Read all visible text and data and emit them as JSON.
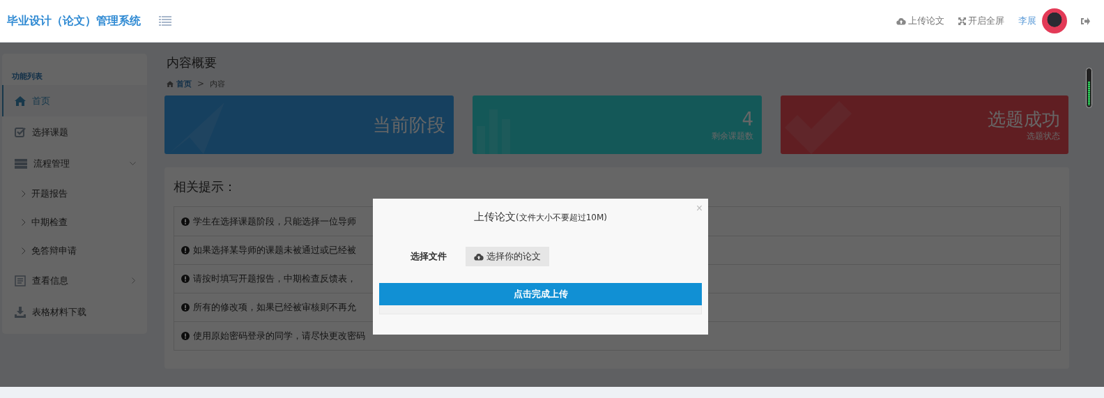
{
  "header": {
    "title": "毕业设计（论文）管理系统",
    "actions": [
      {
        "kind": "upload",
        "label": "上传论文"
      },
      {
        "kind": "fullscreen",
        "label": "开启全屏"
      }
    ],
    "user": {
      "name": "李展"
    }
  },
  "sidebar": {
    "heading": "功能列表",
    "items": [
      {
        "kind": "home",
        "label": "首页",
        "selected": true
      },
      {
        "kind": "check",
        "label": "选择课题",
        "selected": false
      },
      {
        "kind": "stack",
        "label": "流程管理",
        "selected": false,
        "expanded": true,
        "children": [
          {
            "label": "开题报告",
            "selected": false
          },
          {
            "label": "中期检查",
            "selected": false
          },
          {
            "label": "免答辩申请",
            "selected": false
          }
        ]
      },
      {
        "kind": "form",
        "label": "查看信息",
        "selected": false,
        "expanded": false
      },
      {
        "kind": "download",
        "label": "表格材料下载",
        "selected": false
      }
    ]
  },
  "page": {
    "title": "内容概要",
    "breadcrumb": [
      "首页",
      ">",
      "内容"
    ],
    "cards": [
      {
        "kind": "plane",
        "value": "当前阶段",
        "color": "#16405f"
      },
      {
        "kind": "bars",
        "value": "4",
        "label": "剩余课题数",
        "color": "#145858"
      },
      {
        "kind": "check",
        "value": "选题成功",
        "label": "选题状态",
        "color": "#601e22"
      }
    ],
    "tips": {
      "title": "相关提示：",
      "items": [
        "学生在选择课题阶段，只能选择一位导师",
        "如果选择某导师的课题未被通过或已经被",
        "请按时填写开题报告，中期检查反馈表，",
        "所有的修改项，如果已经被审核则不再允",
        "使用原始密码登录的同学，请尽快更改密码"
      ]
    }
  },
  "modal": {
    "title": "上传论文",
    "note": "(文件大小不要超过10M)",
    "close": "×",
    "field_label": "选择文件",
    "file_button": "选择你的论文",
    "submit": "点击完成上传"
  }
}
